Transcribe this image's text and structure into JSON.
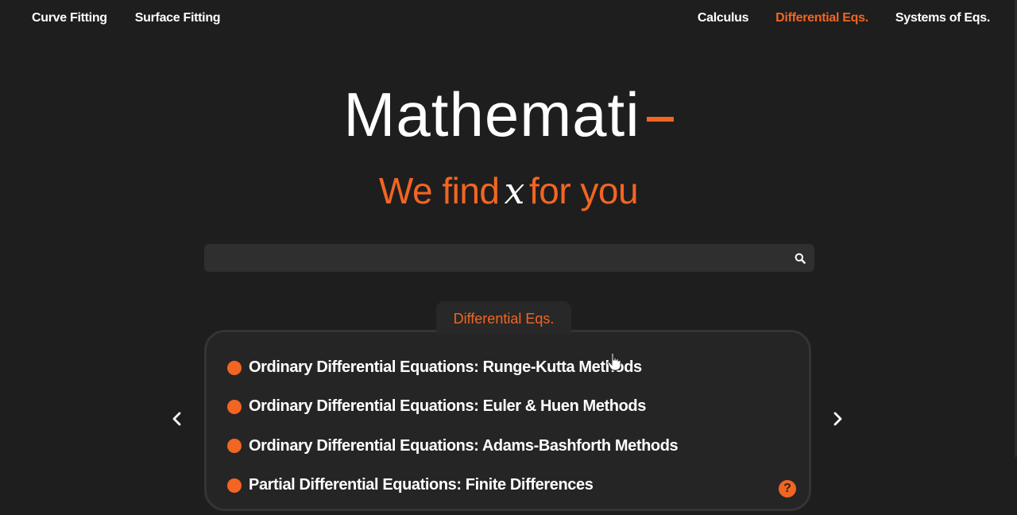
{
  "theme": {
    "accent": "#f26522",
    "background": "#1e1e1e",
    "panel": "#252525"
  },
  "nav": {
    "left": [
      {
        "label": "Curve Fitting"
      },
      {
        "label": "Surface Fitting"
      }
    ],
    "right": [
      {
        "label": "Calculus"
      },
      {
        "label": "Differential Eqs.",
        "active": true
      },
      {
        "label": "Systems of Eqs."
      }
    ]
  },
  "hero": {
    "logo_text": "Mathemati",
    "tagline_before": "We find",
    "tagline_variable": "x",
    "tagline_after": "for you"
  },
  "search": {
    "value": "",
    "icon": "search-icon"
  },
  "category": {
    "tab_label": "Differential Eqs.",
    "items": [
      {
        "label": "Ordinary Differential Equations: Runge-Kutta Methods"
      },
      {
        "label": "Ordinary Differential Equations: Euler & Huen Methods"
      },
      {
        "label": "Ordinary Differential Equations: Adams-Bashforth Methods"
      },
      {
        "label": "Partial Differential Equations: Finite Differences"
      }
    ],
    "help_icon": "question-mark",
    "prev_icon": "chevron-left-icon",
    "next_icon": "chevron-right-icon"
  }
}
